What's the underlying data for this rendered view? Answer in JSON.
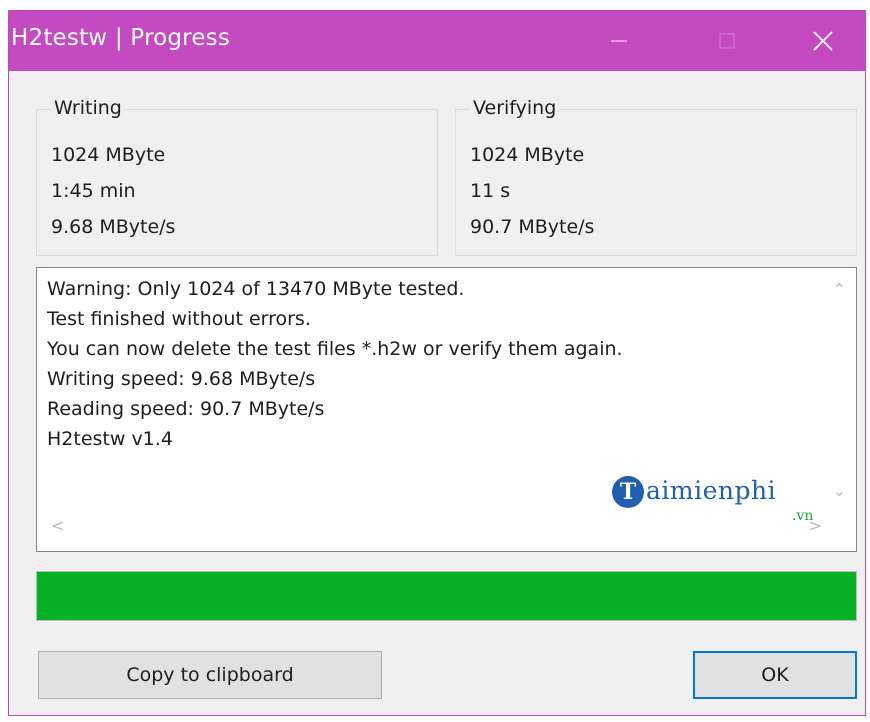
{
  "window": {
    "title": "H2testw | Progress",
    "accent_color": "#c34ac0"
  },
  "titlebar_buttons": {
    "minimize_icon": "minimize-icon",
    "maximize_icon": "maximize-icon",
    "close_icon": "close-icon"
  },
  "writing": {
    "label": "Writing",
    "size": "1024 MByte",
    "time": "1:45 min",
    "speed": "9.68 MByte/s"
  },
  "verifying": {
    "label": "Verifying",
    "size": "1024 MByte",
    "time": "11 s",
    "speed": "90.7 MByte/s"
  },
  "log": {
    "lines": [
      "Warning: Only 1024 of 13470 MByte tested.",
      "Test finished without errors.",
      "You can now delete the test files *.h2w or verify them again.",
      "Writing speed: 9.68 MByte/s",
      "Reading speed: 90.7 MByte/s",
      "H2testw v1.4"
    ]
  },
  "watermark": {
    "logo_letter": "T",
    "brand": "aimienphi",
    "domain": ".vn"
  },
  "progress": {
    "fraction": 1.0,
    "color": "#06b025"
  },
  "buttons": {
    "copy_label": "Copy to clipboard",
    "ok_label": "OK"
  }
}
